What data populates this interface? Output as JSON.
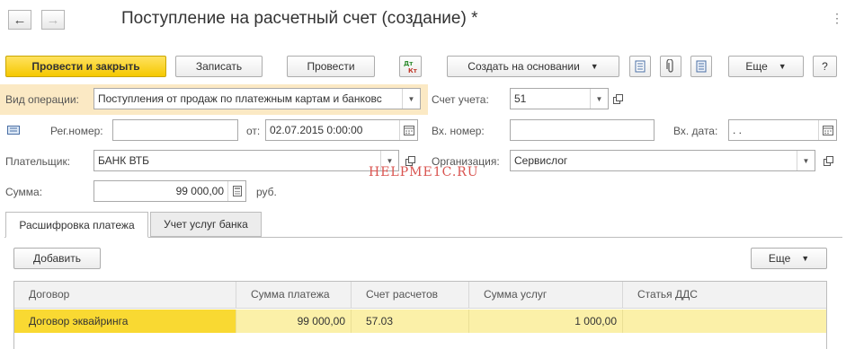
{
  "window": {
    "title": "Поступление на расчетный счет (создание) *",
    "back_icon": "arrow-left-icon",
    "forward_icon": "arrow-right-icon",
    "menu_icon": "more-vertical-icon",
    "menu_glyph": "⋮"
  },
  "toolbar": {
    "post_close_label": "Провести и закрыть",
    "save_label": "Записать",
    "post_label": "Провести",
    "dtkt_icon": "dt-kt-icon",
    "create_based_label": "Создать на основании",
    "more_label": "Еще",
    "help_label": "?"
  },
  "form": {
    "operation_type": {
      "label": "Вид операции:",
      "value": "Поступления от продаж по платежным картам и банковс"
    },
    "account": {
      "label": "Счет учета:",
      "value": "51"
    },
    "reg_number": {
      "label": "Рег.номер:",
      "value": ""
    },
    "date": {
      "label": "от:",
      "value": "02.07.2015  0:00:00"
    },
    "in_number": {
      "label": "Вх. номер:",
      "value": ""
    },
    "in_date": {
      "label": "Вх. дата:",
      "value": " .  ."
    },
    "payer": {
      "label": "Плательщик:",
      "value": "БАНК ВТБ"
    },
    "organization": {
      "label": "Организация:",
      "value": "Сервислог"
    },
    "amount": {
      "label": "Сумма:",
      "value": "99 000,00",
      "currency": "руб."
    }
  },
  "watermark": "HELPME1C.RU",
  "tabs": [
    {
      "label": "Расшифровка платежа",
      "active": true
    },
    {
      "label": "Учет услуг банка",
      "active": false
    }
  ],
  "table_toolbar": {
    "add_label": "Добавить",
    "more_label": "Еще"
  },
  "table": {
    "columns": [
      "Договор",
      "Сумма платежа",
      "Счет расчетов",
      "Сумма услуг",
      "Статья ДДС"
    ],
    "rows": [
      [
        "Договор эквайринга",
        "99 000,00",
        "57.03",
        "1 000,00",
        ""
      ]
    ]
  },
  "colors": {
    "primary_button": "#f5c800",
    "highlight_row": "#fbe9c4",
    "selected_row": "#fbf0a8",
    "watermark": "#d9534f"
  }
}
